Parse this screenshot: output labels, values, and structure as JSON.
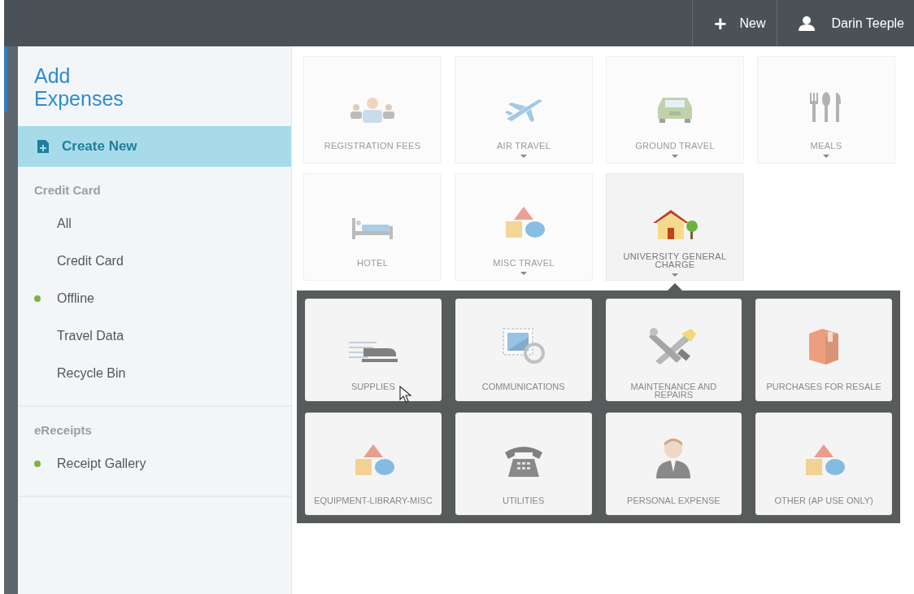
{
  "top_bar": {
    "new_button": {
      "icon": "+",
      "label": "New"
    },
    "user": {
      "name": "Darin Teeple"
    }
  },
  "sidebar": {
    "title": "Add Expenses",
    "create_button": {
      "label": "Create New",
      "selected": true
    },
    "sections": [
      {
        "header": "Credit Card",
        "items": [
          {
            "label": "All"
          },
          {
            "label": "Credit Card"
          },
          {
            "label": "Offline",
            "color": "#7cb342"
          },
          {
            "label": "Travel Data"
          },
          {
            "label": "Recycle Bin"
          }
        ]
      },
      {
        "header": "eReceipts",
        "items": [
          {
            "label": "Receipt Gallery",
            "color": "#7cb342"
          }
        ]
      }
    ]
  },
  "categories": [
    {
      "label": "REGISTRATION FEES",
      "kind": "people",
      "has_submenu": false,
      "selected": false
    },
    {
      "label": "AIR TRAVEL",
      "kind": "plane",
      "has_submenu": true,
      "selected": false
    },
    {
      "label": "GROUND TRAVEL",
      "kind": "car",
      "has_submenu": true,
      "selected": false
    },
    {
      "label": "MEALS",
      "kind": "utensils",
      "has_submenu": true,
      "selected": false
    },
    {
      "label": "HOTEL",
      "kind": "bed",
      "has_submenu": false,
      "selected": false
    },
    {
      "label": "MISC TRAVEL",
      "kind": "shapes",
      "has_submenu": true,
      "selected": false
    },
    {
      "label": "UNIVERSITY GENERAL CHARGE",
      "kind": "house",
      "has_submenu": true,
      "selected": true
    }
  ],
  "subcategories": [
    {
      "label": "SUPPLIES",
      "kind": "stapler"
    },
    {
      "label": "COMMUNICATIONS",
      "kind": "stamp"
    },
    {
      "label": "MAINTENANCE AND REPAIRS",
      "kind": "tools"
    },
    {
      "label": "PURCHASES FOR RESALE",
      "kind": "box"
    },
    {
      "label": "EQUIPMENT-LIBRARY-MISC",
      "kind": "shapes"
    },
    {
      "label": "UTILITIES",
      "kind": "phone"
    },
    {
      "label": "PERSONAL EXPENSE",
      "kind": "person"
    },
    {
      "label": "OTHER (AP USE ONLY)",
      "kind": "shapes"
    }
  ]
}
